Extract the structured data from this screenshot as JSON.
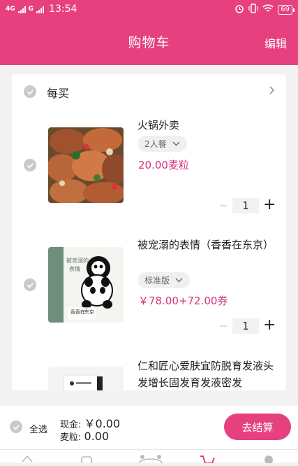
{
  "status": {
    "network1": "4G",
    "network2": "G",
    "time": "13:54",
    "battery": "69"
  },
  "header": {
    "title": "购物车",
    "edit_label": "编辑"
  },
  "store": {
    "name": "每买"
  },
  "items": [
    {
      "title": "火锅外卖",
      "spec": "2人餐",
      "price": "20.00麦粒",
      "qty": "1"
    },
    {
      "title": "被宠溺的表情（香香在东京）",
      "spec": "标准版",
      "price": "￥78.00+72.00券",
      "qty": "1",
      "image_text": {
        "line1": "被宠溺的",
        "line2": "表情",
        "line3": "香香在",
        "line4": "东京"
      }
    },
    {
      "title": "仁和匠心爱肤宜防脱育发液头发增长固发育发液密发"
    }
  ],
  "footer": {
    "select_all": "全选",
    "cash_label": "现金:",
    "cash_value": "￥0.00",
    "points_label": "麦粒:",
    "points_value": "0.00",
    "checkout": "去结算"
  },
  "colors": {
    "accent": "#e6407f",
    "price": "#d4337a"
  }
}
